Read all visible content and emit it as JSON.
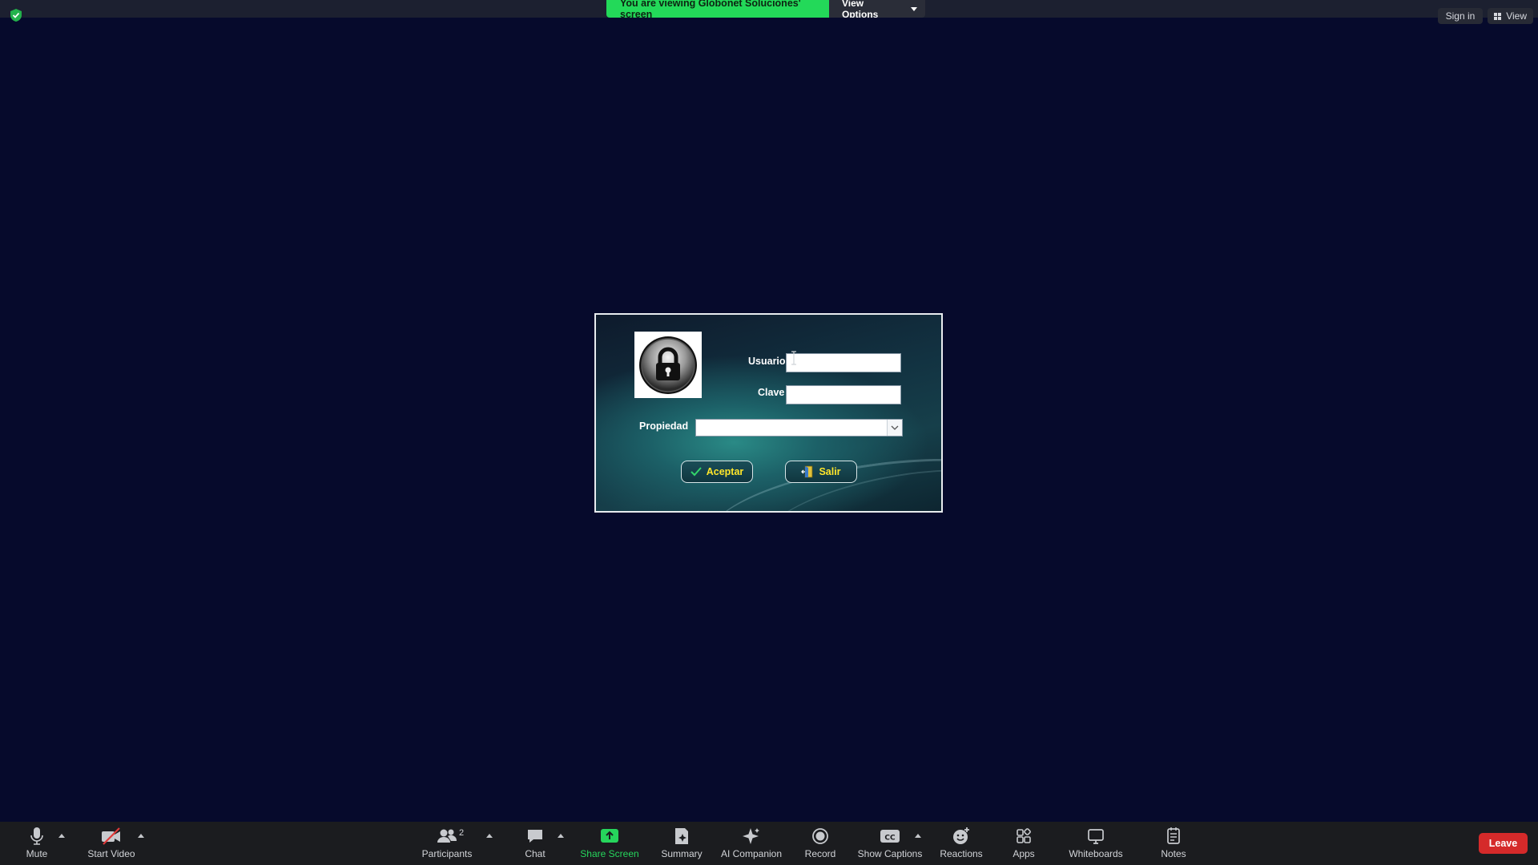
{
  "banner": {
    "viewing_text": "You are viewing Globonet Soluciones' screen",
    "view_options_label": "View Options"
  },
  "top_right": {
    "sign_in_label": "Sign in",
    "view_label": "View"
  },
  "login_dialog": {
    "usuario_label": "Usuario",
    "usuario_value": "",
    "clave_label": "Clave",
    "clave_value": "",
    "propiedad_label": "Propiedad",
    "propiedad_selected": "",
    "aceptar_label": "Aceptar",
    "salir_label": "Salir"
  },
  "toolbar": {
    "mute_label": "Mute",
    "start_video_label": "Start Video",
    "participants_label": "Participants",
    "participants_count": "2",
    "chat_label": "Chat",
    "share_screen_label": "Share Screen",
    "summary_label": "Summary",
    "ai_companion_label": "AI Companion",
    "record_label": "Record",
    "show_captions_label": "Show Captions",
    "reactions_label": "Reactions",
    "apps_label": "Apps",
    "whiteboards_label": "Whiteboards",
    "notes_label": "Notes",
    "leave_label": "Leave"
  },
  "colors": {
    "background": "#060a2c",
    "banner_green": "#23d959",
    "leave_red": "#d52a2a",
    "button_text_yellow": "#ffe62a"
  }
}
